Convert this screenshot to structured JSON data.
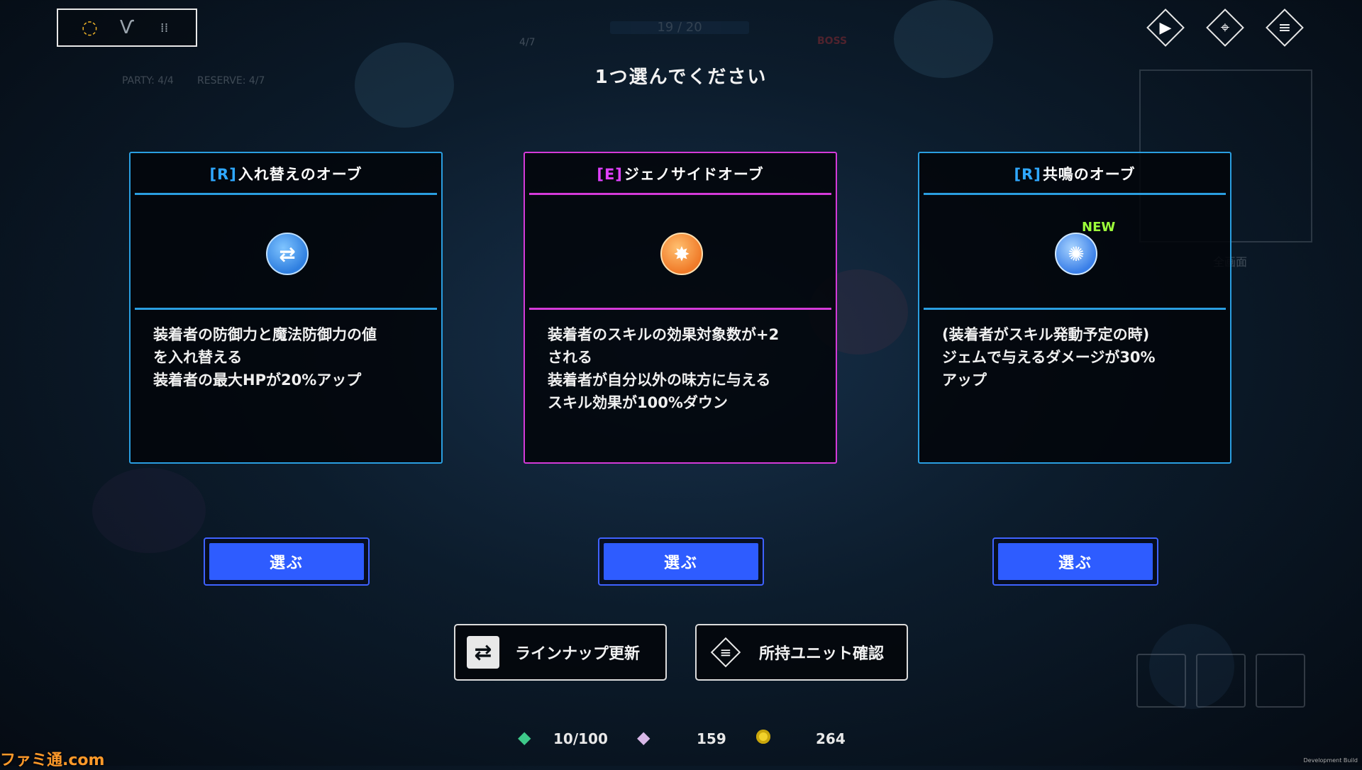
{
  "header": {
    "instruction": "1つ選んでください",
    "equip_tabs": [
      {
        "icon": "ring-icon",
        "glyph": "◌"
      },
      {
        "icon": "necklace-icon",
        "glyph": "Ѵ"
      },
      {
        "icon": "earring-icon",
        "glyph": "⁞⁞"
      }
    ],
    "faded_status": {
      "party": "PARTY: 4/4",
      "reserve": "RESERVE: 4/7",
      "wave": "4/7",
      "progress": "19 / 20",
      "boss": "BOSS",
      "fullscreen": "全画面"
    },
    "top_right_buttons": [
      {
        "name": "play-button",
        "glyph": "▶"
      },
      {
        "name": "map-pin-button",
        "glyph": "⌖"
      },
      {
        "name": "menu-button",
        "glyph": "≡"
      }
    ]
  },
  "cards": [
    {
      "rarity": "[R]",
      "name": "入れ替えのオーブ",
      "rarity_color": "#2fa8ff",
      "border_color": "#2a9ee0",
      "orb_icon": "swap-orb-icon",
      "orb_glyph": "⇄",
      "orb_color": "#2f7fe0",
      "description": "装着者の防御力と魔法防御力の値\nを入れ替える\n装着者の最大HPが20%アップ",
      "choose_label": "選ぶ"
    },
    {
      "rarity": "[E]",
      "name": "ジェノサイドオーブ",
      "rarity_color": "#e040ff",
      "border_color": "#d43ad8",
      "orb_icon": "burst-orb-icon",
      "orb_glyph": "✸",
      "orb_color": "#f07a28",
      "description": "装着者のスキルの効果対象数が+2\nされる\n装着者が自分以外の味方に与える\nスキル効果が100%ダウン",
      "choose_label": "選ぶ"
    },
    {
      "rarity": "[R]",
      "name": "共鳴のオーブ",
      "rarity_color": "#2fa8ff",
      "border_color": "#2a9ee0",
      "orb_icon": "resonance-orb-icon",
      "orb_glyph": "✺",
      "orb_color": "#3a7fe8",
      "badge": "NEW",
      "description": "(装着者がスキル発動予定の時)\nジェムで与えるダメージが30%\nアップ",
      "choose_label": "選ぶ"
    }
  ],
  "actions": {
    "refresh_label": "ラインナップ更新",
    "owned_units_label": "所持ユニット確認"
  },
  "currency": {
    "gems": "10/100",
    "crystals": "159",
    "coins": "264"
  },
  "watermark": "ファミ通.com",
  "dev_build": "Development Build"
}
